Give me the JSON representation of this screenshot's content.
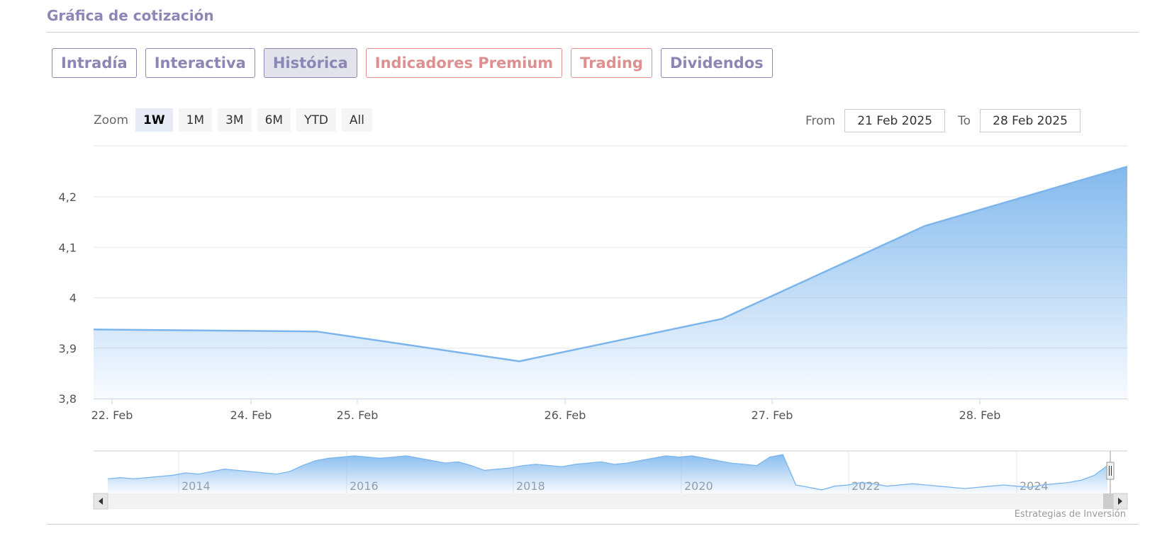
{
  "header": {
    "title": "Gráfica de cotización"
  },
  "tabs": [
    {
      "label": "Intradía",
      "style": "default"
    },
    {
      "label": "Interactiva",
      "style": "default"
    },
    {
      "label": "Histórica",
      "style": "active"
    },
    {
      "label": "Indicadores Premium",
      "style": "premium"
    },
    {
      "label": "Trading",
      "style": "premium"
    },
    {
      "label": "Dividendos",
      "style": "default"
    }
  ],
  "zoom": {
    "label": "Zoom",
    "buttons": [
      "1W",
      "1M",
      "3M",
      "6M",
      "YTD",
      "All"
    ],
    "selected": "1W"
  },
  "range": {
    "from_label": "From",
    "from_value": "21 Feb 2025",
    "to_label": "To",
    "to_value": "28 Feb 2025"
  },
  "credit": "Estrategias de Inversión",
  "colors": {
    "accent": "#8b86b4",
    "premium": "#de8f8f",
    "series_line": "#7cb5ec"
  },
  "chart_data": {
    "type": "area",
    "title": "",
    "xlabel": "",
    "ylabel": "",
    "ylim": [
      3.8,
      4.3
    ],
    "yticks": [
      3.8,
      3.9,
      4.0,
      4.1,
      4.2
    ],
    "ytick_labels": [
      "3,8",
      "3,9",
      "4",
      "4,1",
      "4,2"
    ],
    "x_tick_labels": [
      "22. Feb",
      "24. Feb",
      "25. Feb",
      "26. Feb",
      "27. Feb",
      "28. Feb"
    ],
    "series": [
      {
        "x": [
          -0.1,
          1.0,
          2.0,
          3.0,
          4.0,
          5.0
        ],
        "values": [
          3.937,
          3.933,
          3.874,
          3.958,
          4.142,
          4.26
        ]
      }
    ],
    "x_range": [
      -0.1,
      5.0
    ],
    "grid": true,
    "navigator": {
      "year_labels": [
        "2014",
        "2016",
        "2018",
        "2020",
        "2022",
        "2024"
      ],
      "series": [
        2.7,
        2.8,
        2.7,
        2.8,
        2.9,
        3.0,
        3.2,
        3.1,
        3.3,
        3.5,
        3.4,
        3.3,
        3.2,
        3.1,
        3.3,
        3.8,
        4.2,
        4.4,
        4.5,
        4.6,
        4.5,
        4.4,
        4.5,
        4.6,
        4.4,
        4.2,
        4.0,
        4.1,
        3.8,
        3.4,
        3.5,
        3.6,
        3.8,
        3.9,
        3.8,
        3.7,
        3.9,
        4.0,
        4.1,
        3.9,
        4.0,
        4.2,
        4.4,
        4.6,
        4.5,
        4.6,
        4.4,
        4.2,
        4.0,
        3.9,
        3.8,
        4.5,
        4.7,
        2.2,
        2.0,
        1.8,
        2.1,
        2.2,
        2.4,
        2.3,
        2.1,
        2.2,
        2.3,
        2.2,
        2.1,
        2.0,
        1.9,
        2.0,
        2.1,
        2.2,
        2.1,
        2.0,
        2.2,
        2.3,
        2.4,
        2.6,
        3.0,
        3.8
      ],
      "ylim": [
        1.5,
        5.0
      ]
    }
  }
}
